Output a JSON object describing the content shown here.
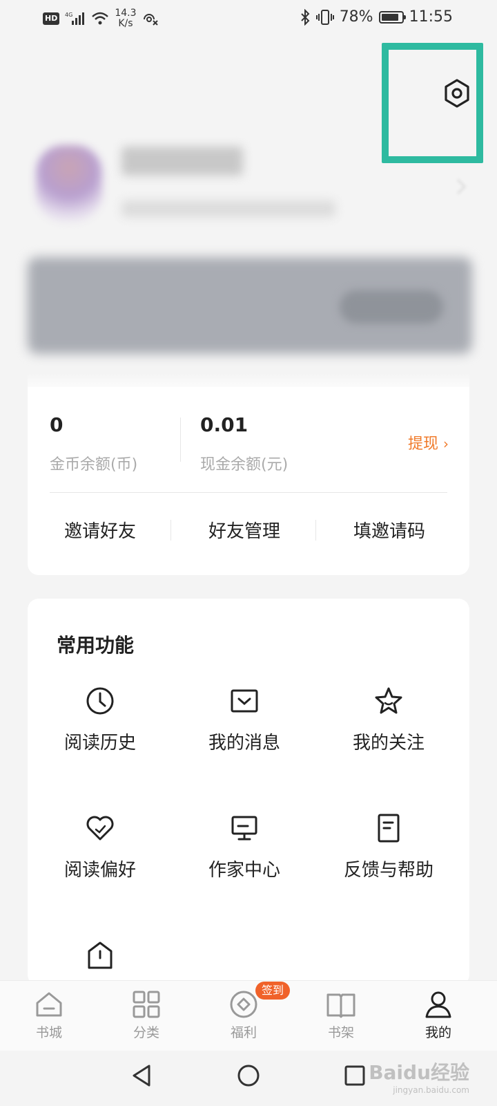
{
  "status_bar": {
    "hd": "HD",
    "network": "4G",
    "speed_value": "14.3",
    "speed_unit": "K/s",
    "battery": "78%",
    "time": "11:55"
  },
  "header": {
    "settings_icon": "settings-hexagon-icon",
    "highlight_color": "#2ebaa0"
  },
  "wallet": {
    "coins_value": "0",
    "coins_label": "金币余额(币)",
    "cash_value": "0.01",
    "cash_label": "现金余额(元)",
    "withdraw_label": "提现",
    "actions": [
      "邀请好友",
      "好友管理",
      "填邀请码"
    ]
  },
  "functions": {
    "title": "常用功能",
    "items": [
      {
        "label": "阅读历史",
        "icon": "clock-icon"
      },
      {
        "label": "我的消息",
        "icon": "message-icon"
      },
      {
        "label": "我的关注",
        "icon": "star-icon"
      },
      {
        "label": "阅读偏好",
        "icon": "heart-check-icon"
      },
      {
        "label": "作家中心",
        "icon": "monitor-icon"
      },
      {
        "label": "反馈与帮助",
        "icon": "document-icon"
      }
    ]
  },
  "tabbar": {
    "tabs": [
      {
        "label": "书城",
        "icon": "home-icon"
      },
      {
        "label": "分类",
        "icon": "grid-icon"
      },
      {
        "label": "福利",
        "icon": "coin-icon"
      },
      {
        "label": "书架",
        "icon": "book-icon"
      },
      {
        "label": "我的",
        "icon": "person-icon"
      }
    ],
    "active_index": 4,
    "welfare_badge": "签到",
    "accent_color": "#f0622a"
  },
  "watermark": {
    "text": "Baidu经验",
    "sub": "jingyan.baidu.com"
  }
}
